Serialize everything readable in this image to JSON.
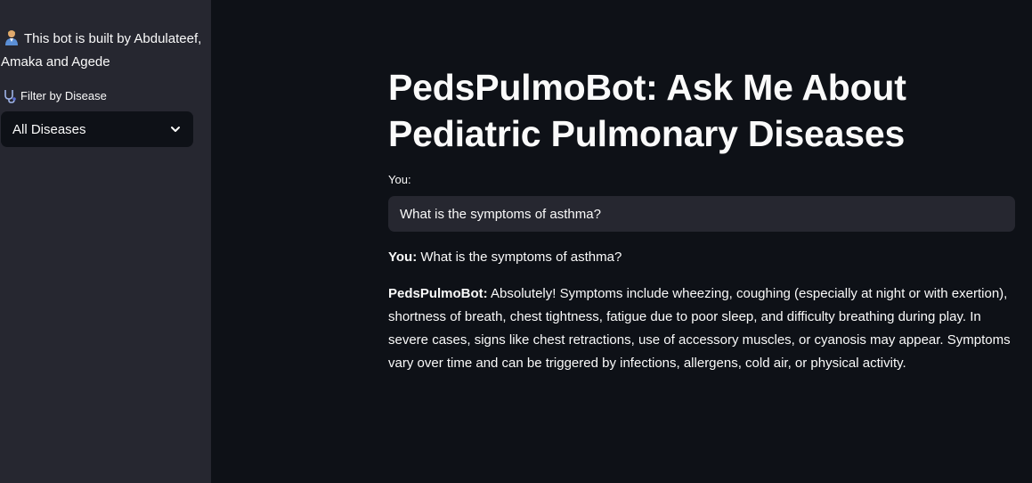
{
  "sidebar": {
    "built_by_text": "This bot is built by Abdulateef, Amaka and Agede",
    "filter_label": "Filter by Disease",
    "filter_selected": "All Diseases"
  },
  "main": {
    "title": "PedsPulmoBot: Ask Me About Pediatric Pulmonary Diseases",
    "input_label": "You:",
    "input_value": "What is the symptoms of asthma?",
    "conversation": [
      {
        "speaker": "You:",
        "text": "What is the symptoms of asthma?"
      },
      {
        "speaker": "PedsPulmoBot:",
        "text": "Absolutely! Symptoms include wheezing, coughing (especially at night or with exertion), shortness of breath, chest tightness, fatigue due to poor sleep, and difficulty breathing during play. In severe cases, signs like chest retractions, use of accessory muscles, or cyanosis may appear. Symptoms vary over time and can be triggered by infections, allergens, cold air, or physical activity."
      }
    ]
  },
  "icons": {
    "person": "doctor-person-icon",
    "stethoscope": "stethoscope-icon",
    "dropdown": "chevron-down-icon"
  },
  "colors": {
    "background": "#0e1117",
    "sidebar": "#262730",
    "input_bg": "#262730",
    "text": "#fafafa"
  }
}
